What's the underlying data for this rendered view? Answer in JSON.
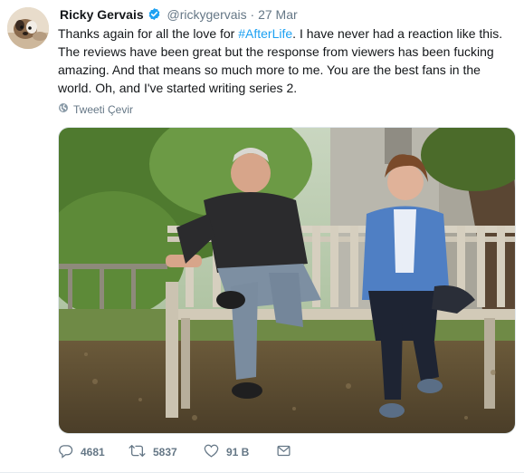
{
  "tweet": {
    "author_name": "Ricky Gervais",
    "handle": "@rickygervais",
    "separator": "·",
    "date": "27 Mar",
    "text_before": "Thanks again for all the love for ",
    "hashtag": "#AfterLife",
    "text_after": ". I have never had a reaction like this. The reviews have been great but the response from viewers has been fucking amazing. And that means so much more to me. You are the best fans in the world. Oh, and I've started writing series 2.",
    "translate_label": "Tweeti Çevir"
  },
  "actions": {
    "replies": "4681",
    "retweets": "5837",
    "likes": "91 B"
  },
  "icons": {
    "verified": "verified-badge-icon",
    "translate": "globe-icon",
    "reply": "reply-icon",
    "retweet": "retweet-icon",
    "like": "heart-icon",
    "message": "envelope-icon"
  },
  "colors": {
    "link": "#1da1f2",
    "secondary_text": "#657786",
    "primary_text": "#14171a"
  }
}
